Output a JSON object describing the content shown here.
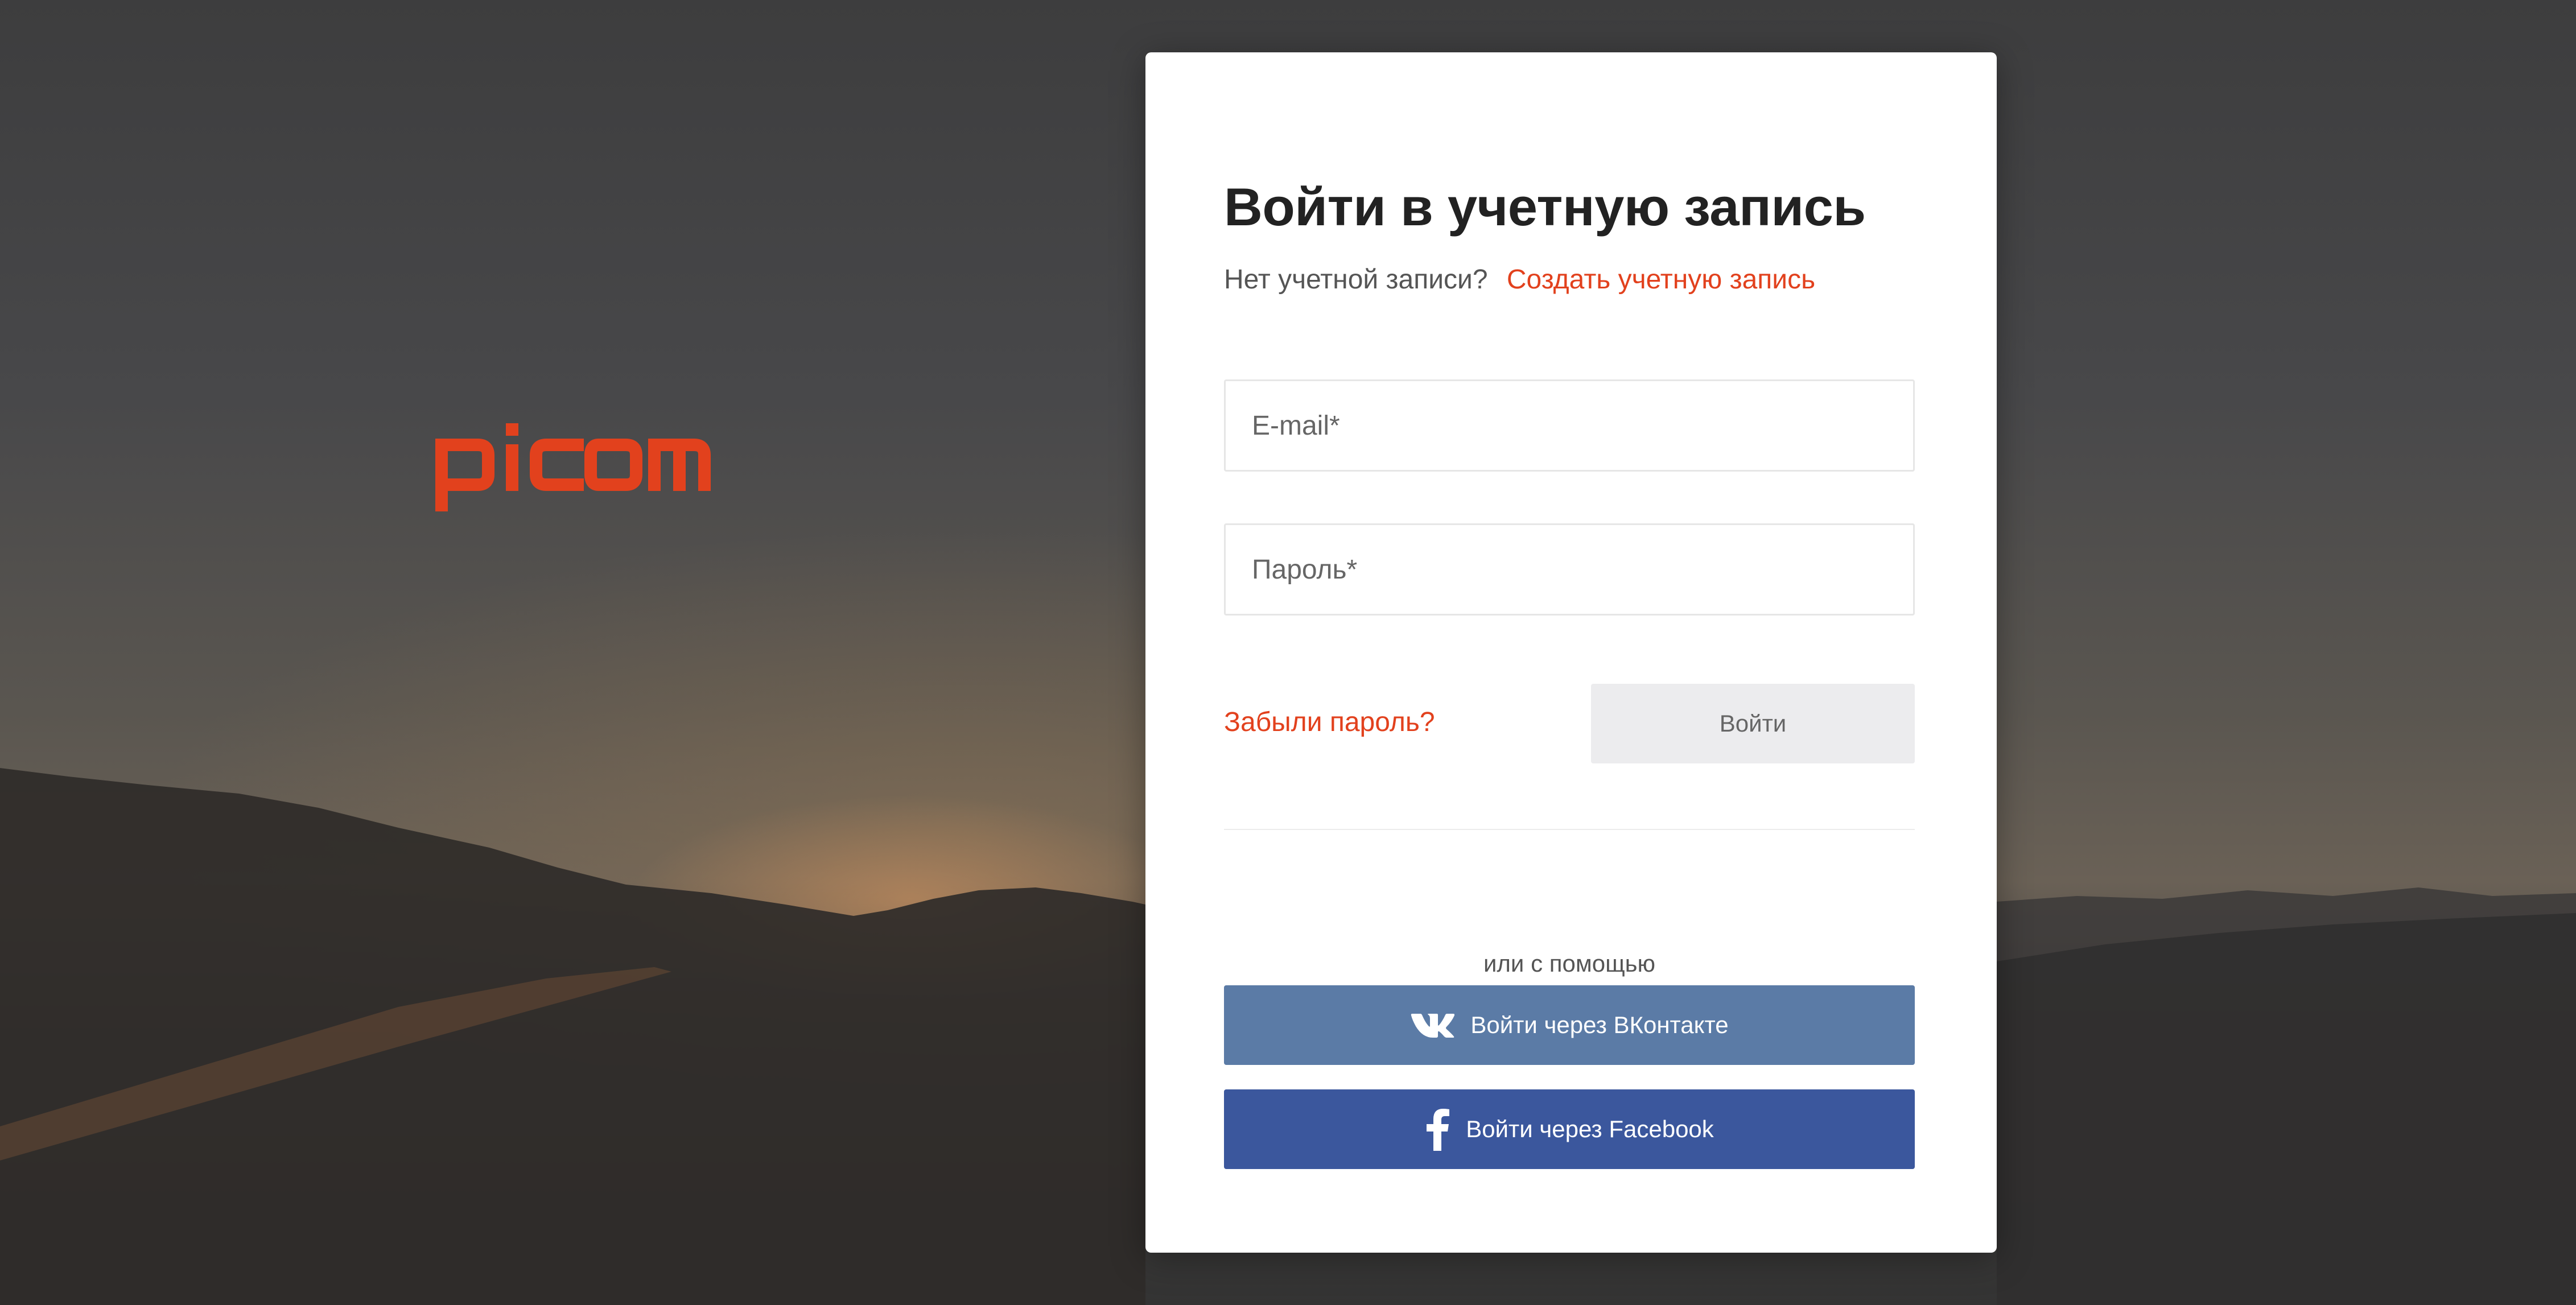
{
  "logo": {
    "text": "picom",
    "color": "#e2411d"
  },
  "login": {
    "title": "Войти в учетную запись",
    "no_account_text": "Нет учетной записи?",
    "create_account_link": "Создать учетную запись",
    "email_placeholder": "E-mail*",
    "password_placeholder": "Пароль*",
    "forgot_password_link": "Забыли пароль?",
    "submit_button": "Войти",
    "or_text": "или с помощью",
    "vk_button": "Войти через ВКонтакте",
    "facebook_button": "Войти через Facebook"
  },
  "colors": {
    "accent": "#e2411d",
    "vk": "#5b7ba6",
    "facebook": "#3b579d",
    "submit_bg": "#ececee"
  },
  "icons": {
    "vk": "vk-icon",
    "facebook": "facebook-icon"
  }
}
